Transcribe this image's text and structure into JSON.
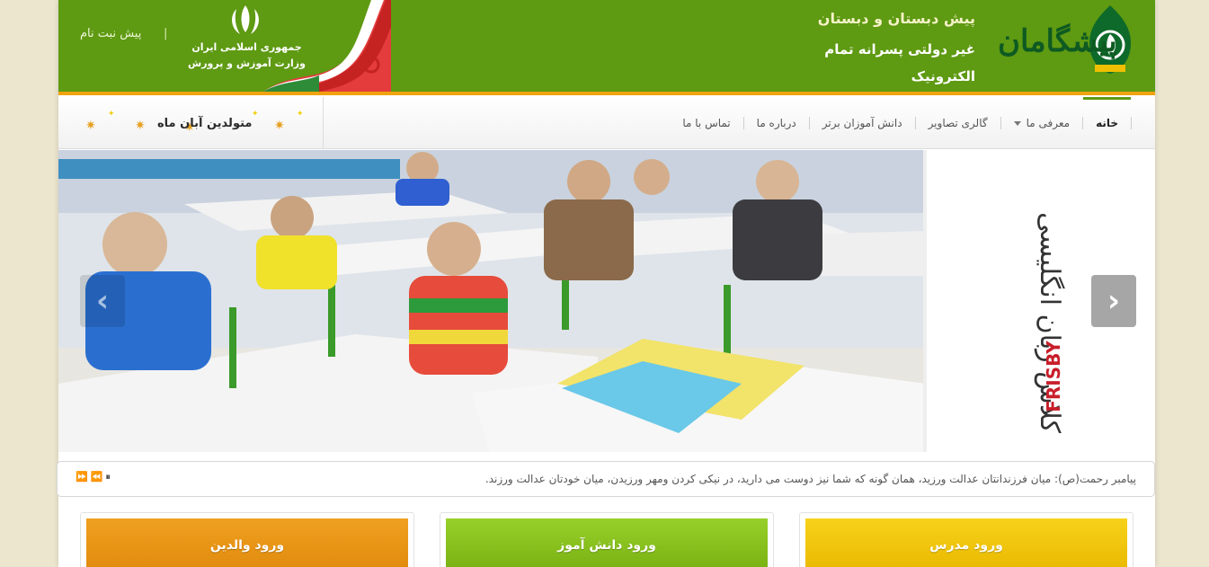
{
  "header": {
    "pre_registration": "پیش نبت نام",
    "emblem_line1": "جمهوری اسلامی ایران",
    "emblem_line2": "وزارت آموزش و پرورش",
    "school_line1": "پیش دبستان و دبستان",
    "school_line2": "غیر دولتی پسرانه تمام الکترونیک",
    "logo_text": "پیشگامان"
  },
  "nav": {
    "items": [
      {
        "label": "خانه",
        "active": true
      },
      {
        "label": "معرفی ما",
        "has_dropdown": true
      },
      {
        "label": "گالری تصاویر"
      },
      {
        "label": "دانش آموزان برتر"
      },
      {
        "label": "درباره ما"
      },
      {
        "label": "تماس با ما"
      }
    ],
    "birthday": "متولدین آبان ماه"
  },
  "slider": {
    "side_caption": "کلاس زبان انگلیسی",
    "side_brand": "FRISBY"
  },
  "ticker": {
    "text": "پیامبر رحمت(ص): میان فرزندانتان عدالت ورزید، همان گونه که شما نیز دوست می دارید، در نیکی کردن ومهر ورزیدن، میان خودتان عدالت ورزند."
  },
  "cards": [
    {
      "label": "ورود مدرس",
      "color": "#f3c400"
    },
    {
      "label": "ورود دانش آموز",
      "color": "#86c21a"
    },
    {
      "label": "ورود والدین",
      "color": "#e89410"
    }
  ],
  "colors": {
    "header_bg": "#5e9a12",
    "header_border": "#f0a20f",
    "page_bg": "#ece6cf"
  }
}
